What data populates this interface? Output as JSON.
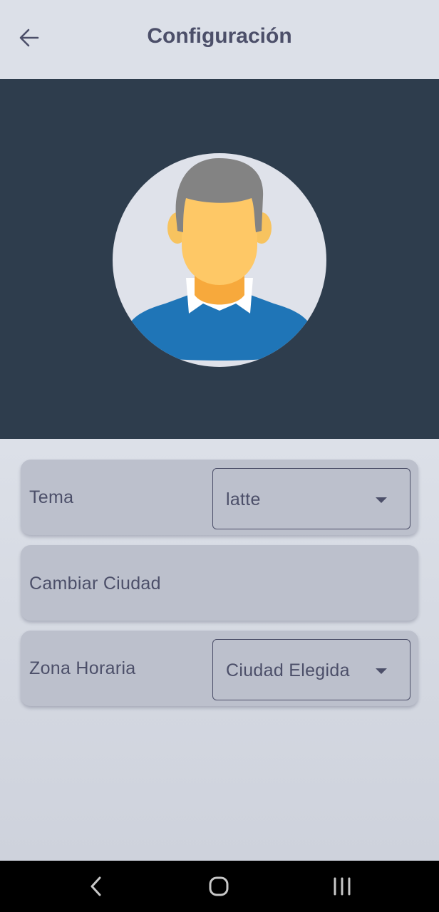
{
  "app_bar": {
    "title": "Configuración",
    "back_icon": "arrow-left-icon"
  },
  "banner": {
    "background_color": "#2e3d4d",
    "avatar_icon": "user-avatar-icon"
  },
  "settings": {
    "theme": {
      "label": "Tema",
      "selected_value": "latte"
    },
    "change_city": {
      "label": "Cambiar Ciudad"
    },
    "timezone": {
      "label": "Zona Horaria",
      "selected_value": "Ciudad Elegida"
    }
  },
  "colors": {
    "text": "#4c4f69",
    "card": "#bcc0cc",
    "background": "#dce0e8"
  },
  "nav_bar": {
    "back_icon": "nav-back-icon",
    "home_icon": "nav-home-icon",
    "recents_icon": "nav-recents-icon"
  }
}
